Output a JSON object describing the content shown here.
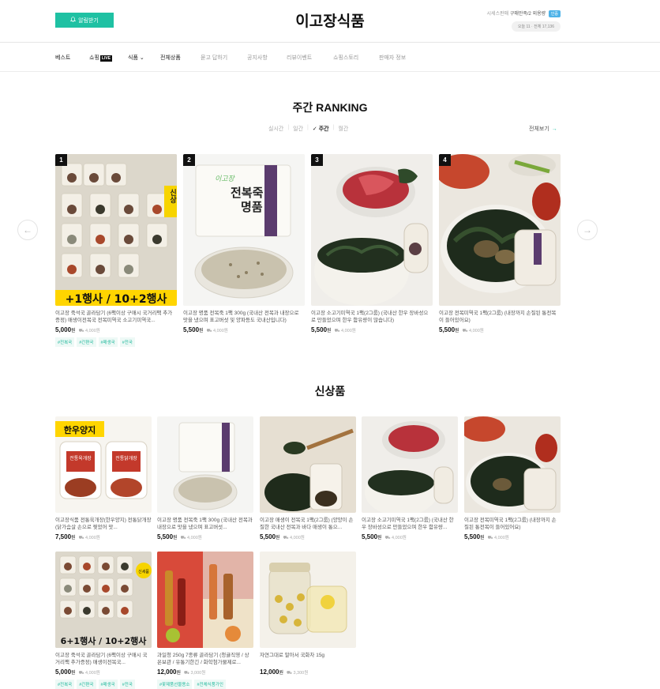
{
  "header": {
    "alarm_label": "알림받기",
    "store_title": "이고장식품",
    "seller_label": "시세스판매",
    "owner": "구매만족/2 외용량",
    "badge": "인증",
    "visitors": "오늘 11 · 전체 17,136"
  },
  "nav": {
    "items": [
      "베스트",
      "쇼핑",
      "식품",
      "전체상품",
      "묻고 답하기",
      "공지사항",
      "리뷰이벤트",
      "쇼핑스토리",
      "판매자 정보"
    ],
    "live_badge": "LIVE"
  },
  "ranking": {
    "title": "주간 RANKING",
    "periods": [
      "실시간",
      "일간",
      "주간",
      "월간"
    ],
    "check": "✓",
    "view_all": "전체보기",
    "items": [
      {
        "rank": "1",
        "name": "이고장 죽석국 골라담기 (6팩이상 구매시 국거리팩 추가증정) 매생이전복국 전복미역국 소고기미역국...",
        "price": "5,000",
        "won": "원",
        "ship": "4,000원",
        "tags": [
          "#전복국",
          "#간편국",
          "#매생국",
          "#전국"
        ]
      },
      {
        "rank": "2",
        "name": "이고장 명품 전복죽 1팩 300g (국내산 전복과 내장으로 맛을 냈으며 표고버섯 및 양파등도 국내산입니다)",
        "price": "5,500",
        "won": "원",
        "ship": "4,000원",
        "tags": []
      },
      {
        "rank": "3",
        "name": "이고장 소고기미역국 1팩(2그룹) (국내산 한우 장바성으로 만들었으며 한우 함유량이 많습니다)",
        "price": "5,500",
        "won": "원",
        "ship": "4,000원",
        "tags": []
      },
      {
        "rank": "4",
        "name": "이고장 전복미역국 1팩(2그룹) (내장까지 손질된 통전복이 들어있어요)",
        "price": "5,500",
        "won": "원",
        "ship": "4,000원",
        "tags": []
      }
    ]
  },
  "new_products": {
    "title": "신상품",
    "items": [
      {
        "name": "이고장식품 전통육개장(한우양지) 전통닭개장(닭가슴살 손으로 찢었어 맛...",
        "price": "7,500",
        "won": "원",
        "ship": "4,000원",
        "tags": []
      },
      {
        "name": "이고장 명품 전복죽 1팩 300g (국내산 전복과 내장으로 맛을 냈으며 표고버섯...",
        "price": "5,500",
        "won": "원",
        "ship": "4,000원",
        "tags": []
      },
      {
        "name": "이고장 매생이 전복국 1팩(2그룹) (양양이 손질한 국내산 전복과 바다 매생이 통으...",
        "price": "5,500",
        "won": "원",
        "ship": "4,000원",
        "tags": []
      },
      {
        "name": "이고장 소고기미역국 1팩(2그룹) (국내산 한우 장바성으로 만들었으며 한우 함유량...",
        "price": "5,500",
        "won": "원",
        "ship": "4,000원",
        "tags": []
      },
      {
        "name": "이고장 전복미역국 1팩(2그룹) (내장까지 손질된 통전복이 들어있어요)",
        "price": "5,500",
        "won": "원",
        "ship": "4,000원",
        "tags": []
      },
      {
        "name": "이고장 죽석국 골라담기 (6팩이상 구매시 국거리팩 추가증정) 매생이전복국...",
        "price": "5,000",
        "won": "원",
        "ship": "4,000원",
        "tags": [
          "#전복국",
          "#간편국",
          "#매생국",
          "#전국"
        ]
      },
      {
        "name": "과일청 250g 7종류 골라담기 (청귤직영 / 상온보관 / 유통기한긴 / 화학첨가물제로...",
        "price": "12,000",
        "won": "원",
        "ship": "3,000원",
        "tags": [
          "#꽃제품선물용소",
          "#전체식품가인"
        ]
      },
      {
        "name": "자연그대로 말아서 국화차 15g",
        "price": "12,000",
        "won": "원",
        "ship": "3,300원",
        "tags": []
      }
    ]
  },
  "image_labels": {
    "r1": "+1행사 / 10+2행사",
    "r1_side": "신상",
    "r2_a": "명품",
    "r2_b": "전복죽",
    "r2_brand": "이고장",
    "n1_top": "한우양지",
    "n1_a": "전통육개장",
    "n1_b": "전통닭개장",
    "n6": "6+1행사 / 10+2행사",
    "n6_side": "신세품"
  },
  "colors": {
    "accent": "#1fc1a3",
    "rank_badge": "#111111",
    "tag_text": "#1fb89c"
  }
}
